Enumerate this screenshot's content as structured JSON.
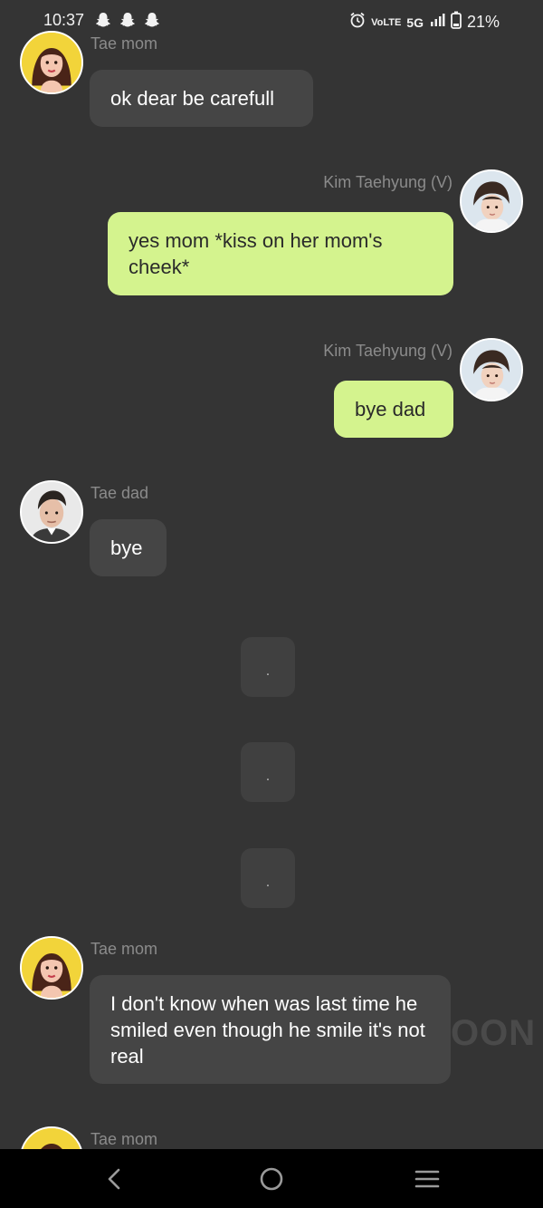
{
  "status_bar": {
    "time": "10:37",
    "battery": "21%",
    "network": "5G",
    "volte": "VoLTE",
    "icons": [
      "snapchat-icon",
      "snapchat-icon",
      "snapchat-icon",
      "alarm-icon",
      "signal-icon",
      "battery-icon"
    ]
  },
  "messages": [
    {
      "sender": "Tae mom",
      "text": "ok dear be carefull",
      "side": "left"
    },
    {
      "sender": "Kim Taehyung (V)",
      "text": "yes mom *kiss on her mom's cheek*",
      "side": "right"
    },
    {
      "sender": "Kim Taehyung (V)",
      "text": "bye dad",
      "side": "right"
    },
    {
      "sender": "Tae dad",
      "text": "bye",
      "side": "left"
    },
    {
      "sender": "Tae mom",
      "text": "I don't know when was last time he smiled even though he smile it's not real",
      "side": "left"
    },
    {
      "sender": "Tae mom",
      "text": "",
      "side": "left"
    }
  ],
  "narration": [
    ".",
    ".",
    "."
  ],
  "watermark": "OON",
  "nav": {
    "back": "back-icon",
    "home": "home-icon",
    "menu": "menu-icon"
  },
  "colors": {
    "background": "#343434",
    "user_bubble": "#d4f38e",
    "other_bubble": "#454545",
    "name": "#8b8b8b"
  }
}
